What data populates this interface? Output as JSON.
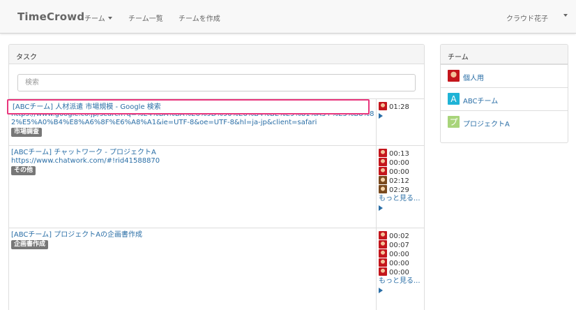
{
  "brand": "TimeCrowd",
  "nav": {
    "team_menu": "チーム",
    "team_list": "チーム一覧",
    "create_team": "チームを作成",
    "user_name": "クラウド花子"
  },
  "tasks_panel": {
    "heading": "タスク",
    "search_placeholder": "検索",
    "rows": [
      {
        "title": "[ABCチーム] 人材派遣 市場規模 - Google 検索",
        "url": "https://www.google.co.jp/search?q=%E4%BA%BA%E6%9D%90%E6%B4%BE%E9%81%A3+%E5%B8%82%E5%A0%B4%E8%A6%8F%E6%A8%A1&ie=UTF-8&oe=UTF-8&hl=ja-jp&client=safari",
        "label": "市場調査",
        "entries": [
          {
            "avatar": "user-avatar-red",
            "time": "01:28"
          }
        ],
        "more": ""
      },
      {
        "title": "[ABCチーム] チャットワーク - プロジェクトA",
        "url": "https://www.chatwork.com/#!rid41588870",
        "label": "その他",
        "entries": [
          {
            "avatar": "user-avatar-red",
            "time": "00:13"
          },
          {
            "avatar": "user-avatar-red",
            "time": "00:00"
          },
          {
            "avatar": "user-avatar-red",
            "time": "00:00"
          },
          {
            "avatar": "user-avatar-brown",
            "time": "02:12"
          },
          {
            "avatar": "user-avatar-brown",
            "time": "02:29"
          }
        ],
        "more": "もっと見る..."
      },
      {
        "title": "[ABCチーム] プロジェクトAの企画書作成",
        "url": "",
        "label": "企画書作成",
        "entries": [
          {
            "avatar": "user-avatar-red",
            "time": "00:02"
          },
          {
            "avatar": "user-avatar-red",
            "time": "00:07"
          },
          {
            "avatar": "user-avatar-red",
            "time": "00:00"
          },
          {
            "avatar": "user-avatar-red",
            "time": "00:00"
          },
          {
            "avatar": "user-avatar-red",
            "time": "00:00"
          }
        ],
        "more": "もっと見る..."
      }
    ]
  },
  "teams_panel": {
    "heading": "チーム",
    "items": [
      {
        "name": "個人用",
        "icon": "user-avatar-red",
        "color": "#c4161c",
        "glyph": ""
      },
      {
        "name": "ABCチーム",
        "icon": "team-a-icon",
        "color": "#1fb3d6",
        "glyph": "A"
      },
      {
        "name": "プロジェクトA",
        "icon": "team-pu-icon",
        "color": "#a8d47a",
        "glyph": "プ"
      }
    ]
  }
}
